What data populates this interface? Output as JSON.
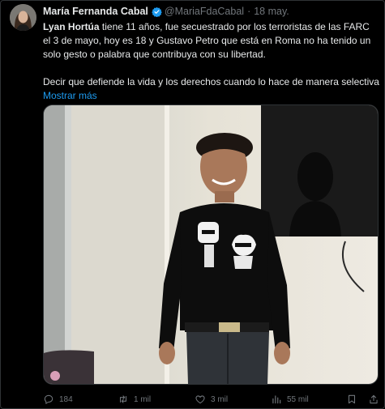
{
  "author": {
    "name": "María Fernanda Cabal",
    "handle": "@MariaFdaCabal",
    "separator": "·",
    "date": "18 may."
  },
  "tweet": {
    "mention": "Lyan Hortúa",
    "text1_rest": " tiene 11 años, fue secuestrado por los terroristas de las FARC el 3 de mayo, hoy es 18 y Gustavo Petro que está en Roma no ha tenido un solo gesto o palabra que contribuya con su libertad.",
    "text2": "Decir que defiende la vida y los derechos cuando lo hace de manera selectiva",
    "show_more": "Mostrar más"
  },
  "media": {
    "shirt_print": "KARL LAGERFELD"
  },
  "actions": {
    "replies": "184",
    "retweets": "1 mil",
    "likes": "3 mil",
    "views": "55 mil"
  },
  "icons": [
    "verified-badge-icon",
    "reply-icon",
    "retweet-icon",
    "like-icon",
    "views-icon",
    "bookmark-icon",
    "share-icon"
  ],
  "colors": {
    "background": "#000000",
    "text": "#e7e9ea",
    "muted": "#71767b",
    "link": "#1d9bf0",
    "verified": "#1d9bf0"
  }
}
